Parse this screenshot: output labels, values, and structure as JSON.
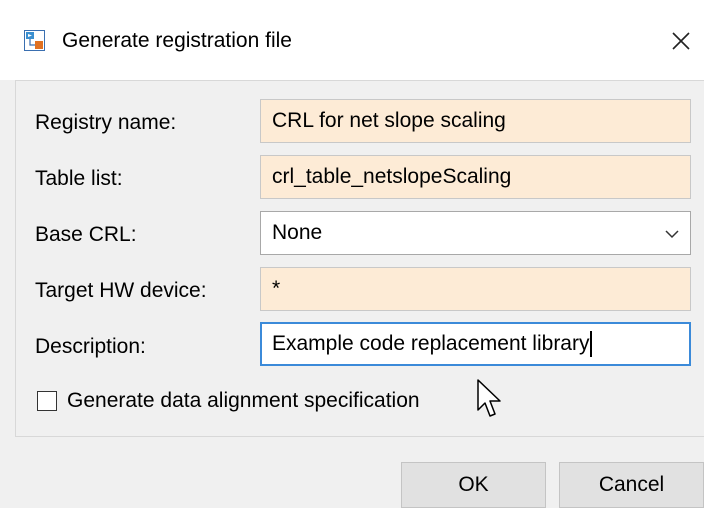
{
  "window": {
    "title": "Generate registration file",
    "icon": "simulink-app-icon",
    "close_icon": "close-icon"
  },
  "form": {
    "registry_name": {
      "label": "Registry name:",
      "value": "CRL for net slope scaling"
    },
    "table_list": {
      "label": "Table list:",
      "value": "crl_table_netslopeScaling"
    },
    "base_crl": {
      "label": "Base CRL:",
      "value": "None",
      "icon": "chevron-down-icon"
    },
    "target_hw_device": {
      "label": "Target HW device:",
      "value": "*"
    },
    "description": {
      "label": "Description:",
      "value": "Example code replacement library"
    }
  },
  "checkbox": {
    "label": "Generate data alignment specification",
    "checked": false
  },
  "buttons": {
    "ok": "OK",
    "cancel": "Cancel"
  },
  "colors": {
    "editable_field_bg": "#fdebd6",
    "focus_border": "#3b8ad9",
    "dialog_bg": "#f0f0f0"
  }
}
